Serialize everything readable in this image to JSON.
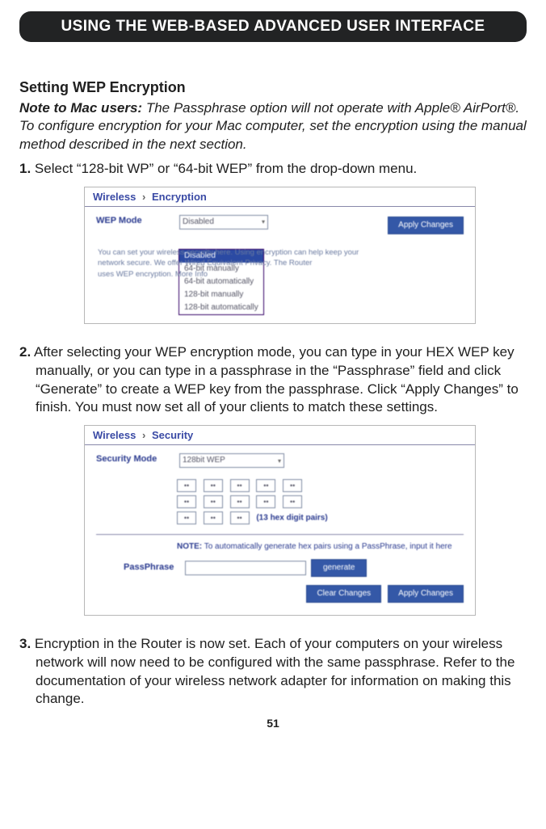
{
  "header": {
    "title": "USING THE WEB-BASED ADVANCED USER INTERFACE"
  },
  "section": {
    "heading": "Setting WEP Encryption"
  },
  "mac_note": {
    "lead": "Note to Mac users:",
    "body": "The Passphrase option will not operate with Apple® AirPort®. To configure encryption for your Mac computer, set the encryption using the manual method described in the next section."
  },
  "steps": {
    "one": {
      "num": "1.",
      "text": "Select “128-bit WP” or “64-bit WEP” from the drop-down menu."
    },
    "two": {
      "num": "2.",
      "text": "After selecting your WEP encryption mode, you can type in your HEX WEP key manually, or you can type in a passphrase in the “Passphrase” field and click “Generate” to create a WEP key from the passphrase. Click “Apply Changes” to finish. You must now set all of your clients to match these settings."
    },
    "three": {
      "num": "3.",
      "text": "Encryption in the Router is now set. Each of your computers on your wireless network will now need to be configured with the same passphrase. Refer to the documentation of your wireless network adapter for information on making this change."
    }
  },
  "shot1": {
    "crumb_a": "Wireless",
    "crumb_b": "Encryption",
    "field_label": "WEP Mode",
    "selected": "Disabled",
    "options": [
      "Disabled",
      "64-bit manually",
      "64-bit automatically",
      "128-bit manually",
      "128-bit automatically"
    ],
    "help_a": "You can set your wireless security here. Using encryption can help keep your",
    "help_b": "network secure. We offer Wired Equivalent Privacy. The Router",
    "help_c": "uses WEP encryption. More Info",
    "apply": "Apply Changes"
  },
  "shot2": {
    "crumb_a": "Wireless",
    "crumb_b": "Security",
    "field_label": "Security Mode",
    "selected": "128bit WEP",
    "hex_val": "••",
    "hex_caption": "(13 hex digit pairs)",
    "note_label": "NOTE:",
    "note_text": "To automatically generate hex pairs using a PassPhrase, input it here",
    "pass_label": "PassPhrase",
    "generate": "generate",
    "clear": "Clear Changes",
    "apply": "Apply Changes"
  },
  "page_number": "51"
}
